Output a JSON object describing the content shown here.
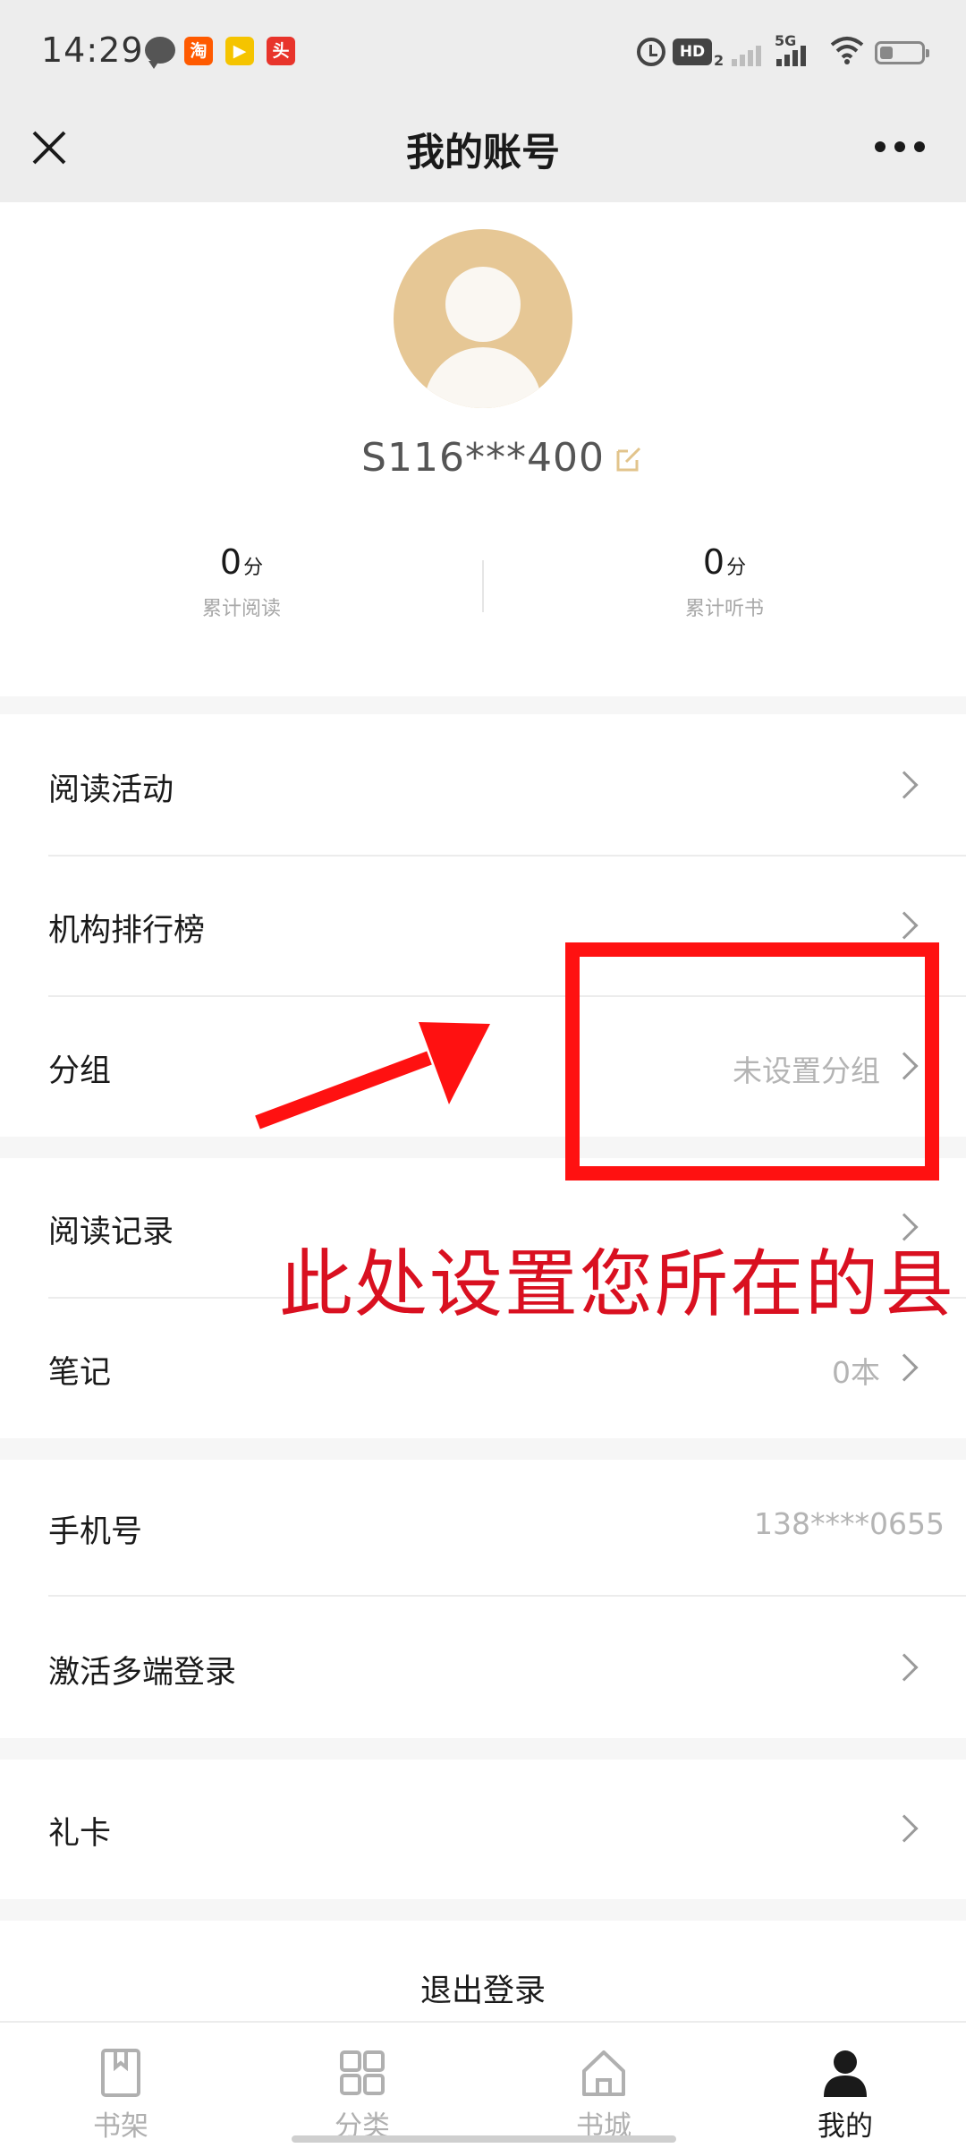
{
  "status_bar": {
    "time": "14:29",
    "notification_icons": [
      "chat-bubble-icon",
      "taobao-icon",
      "video-app-icon",
      "news-app-icon"
    ],
    "app_badges": {
      "taobao": "淘",
      "video": "▶",
      "news": "头"
    },
    "hd_label": "HD",
    "hd_sub": "2",
    "network": "5G"
  },
  "header": {
    "title": "我的账号"
  },
  "profile": {
    "username": "S116***400",
    "stats": [
      {
        "value": "0",
        "unit": "分",
        "label": "累计阅读"
      },
      {
        "value": "0",
        "unit": "分",
        "label": "累计听书"
      }
    ]
  },
  "menu": {
    "reading_activity": {
      "label": "阅读活动"
    },
    "org_ranking": {
      "label": "机构排行榜"
    },
    "group": {
      "label": "分组",
      "value": "未设置分组"
    },
    "reading_history": {
      "label": "阅读记录"
    },
    "notes": {
      "label": "笔记",
      "value": "0本"
    },
    "phone": {
      "label": "手机号",
      "value": "138****0655"
    },
    "multi_login": {
      "label": "激活多端登录"
    },
    "gift_card": {
      "label": "礼卡"
    },
    "logout": "退出登录"
  },
  "annotation": {
    "text": "此处设置您所在的县",
    "color": "#ff1111"
  },
  "tab_bar": {
    "tabs": [
      {
        "label": "书架",
        "icon": "bookshelf-icon"
      },
      {
        "label": "分类",
        "icon": "category-grid-icon"
      },
      {
        "label": "书城",
        "icon": "bookstore-home-icon"
      },
      {
        "label": "我的",
        "icon": "profile-person-icon",
        "active": true
      }
    ]
  },
  "colors": {
    "header_bg": "#ededed",
    "avatar_bg": "#e6c795",
    "muted_text": "#b4b4b4",
    "section_gap": "#f6f6f6"
  }
}
